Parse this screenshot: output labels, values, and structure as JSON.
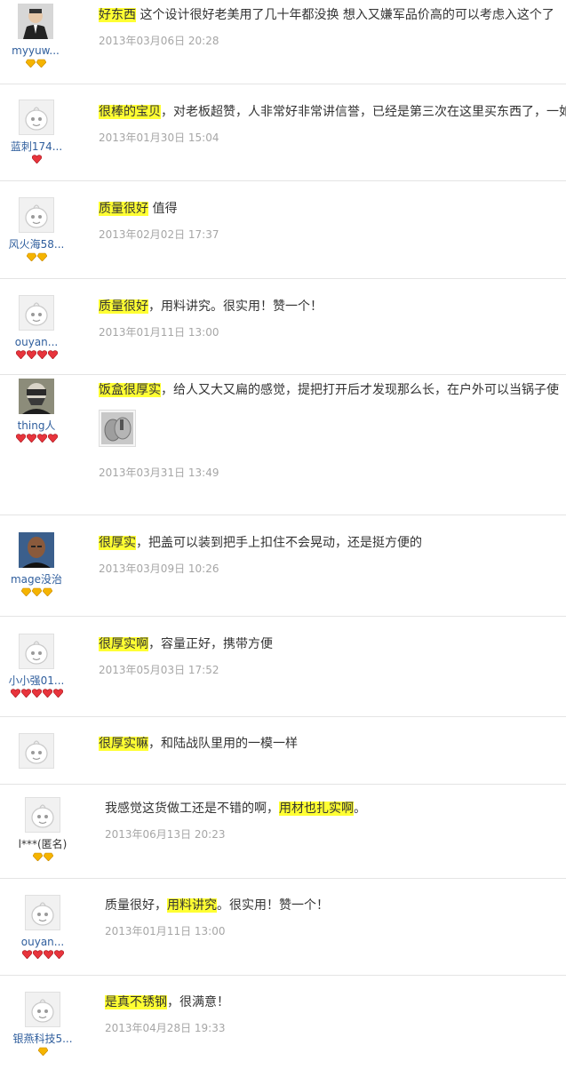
{
  "reviews": [
    {
      "user": "myyuw...",
      "avatar": "photo-man-suit-icon",
      "badges": [
        "gold-diamond-icon",
        "gold-diamond-icon"
      ],
      "highlight": "好东西",
      "text_before": "",
      "text_after": " 这个设计很好老美用了几十年都没换 想入又嫌军品价高的可以考虑入这个了",
      "date": "2013年03月06日 20:28"
    },
    {
      "user": "蓝刺174...",
      "avatar": "default-avatar-icon",
      "badges": [
        "red-heart-icon"
      ],
      "highlight": "很棒的宝贝",
      "text_before": "",
      "text_after": "，对老板超赞，人非常好非常讲信誉，已经是第三次在这里买东西了，一如",
      "date": "2013年01月30日 15:04"
    },
    {
      "user": "风火海58...",
      "avatar": "default-avatar-icon",
      "badges": [
        "gold-diamond-icon",
        "gold-diamond-icon"
      ],
      "highlight": "质量很好",
      "text_before": "",
      "text_after": " 值得",
      "date": "2013年02月02日 17:37"
    },
    {
      "user": "ouyan...",
      "avatar": "default-avatar-icon",
      "badges": [
        "red-heart-icon",
        "red-heart-icon",
        "red-heart-icon",
        "red-heart-icon"
      ],
      "highlight": "质量很好",
      "text_before": "",
      "text_after": "，用料讲究。很实用！赞一个！",
      "date": "2013年01月11日 13:00"
    },
    {
      "user": "thing人",
      "avatar": "photo-masked-icon",
      "badges": [
        "red-heart-icon",
        "red-heart-icon",
        "red-heart-icon",
        "red-heart-icon"
      ],
      "highlight": "饭盒很厚实",
      "text_before": "",
      "text_after": "，给人又大又扁的感觉，提把打开后才发现那么长，在户外可以当锅子使",
      "image": "mess-kit-photo-icon",
      "date": "2013年03月31日 13:49"
    },
    {
      "user": "mage没治",
      "avatar": "photo-bald-man-icon",
      "badges": [
        "gold-diamond-icon",
        "gold-diamond-icon",
        "gold-diamond-icon"
      ],
      "highlight": "很厚实",
      "text_before": "",
      "text_after": "，把盖可以装到把手上扣住不会晃动，还是挺方便的",
      "date": "2013年03月09日 10:26"
    },
    {
      "user": "小小强01...",
      "avatar": "default-avatar-icon",
      "badges": [
        "red-heart-icon",
        "red-heart-icon",
        "red-heart-icon",
        "red-heart-icon",
        "red-heart-icon"
      ],
      "highlight": "很厚实啊",
      "text_before": "",
      "text_after": "，容量正好，携带方便",
      "date": "2013年05月03日 17:52"
    },
    {
      "user": "",
      "avatar": "default-avatar-icon",
      "badges": [],
      "highlight": "很厚实嘛",
      "text_before": "",
      "text_after": "，和陆战队里用的一模一样",
      "date": ""
    },
    {
      "user": "l***(匿名)",
      "avatar": "default-avatar-icon",
      "badges": [
        "gold-diamond-icon",
        "gold-diamond-icon"
      ],
      "highlight": "用材也扎实啊",
      "text_before": "我感觉这货做工还是不错的啊，",
      "text_after": "。",
      "date": "2013年06月13日 20:23"
    },
    {
      "user": "ouyan...",
      "avatar": "default-avatar-icon",
      "badges": [
        "red-heart-icon",
        "red-heart-icon",
        "red-heart-icon",
        "red-heart-icon"
      ],
      "highlight": "用料讲究",
      "text_before": "质量很好，",
      "text_after": "。很实用！赞一个！",
      "date": "2013年01月11日 13:00"
    },
    {
      "user": "银燕科技5...",
      "avatar": "default-avatar-icon",
      "badges": [
        "gold-diamond-icon"
      ],
      "highlight": "是真不锈钢",
      "text_before": "",
      "text_after": "，很满意！",
      "date": "2013年04月28日 19:33"
    }
  ],
  "colors": {
    "highlight": "#ffff33",
    "username": "#2f5e9d",
    "date": "#a6a6a6",
    "gold": "#f5b400",
    "red": "#e8343c"
  }
}
